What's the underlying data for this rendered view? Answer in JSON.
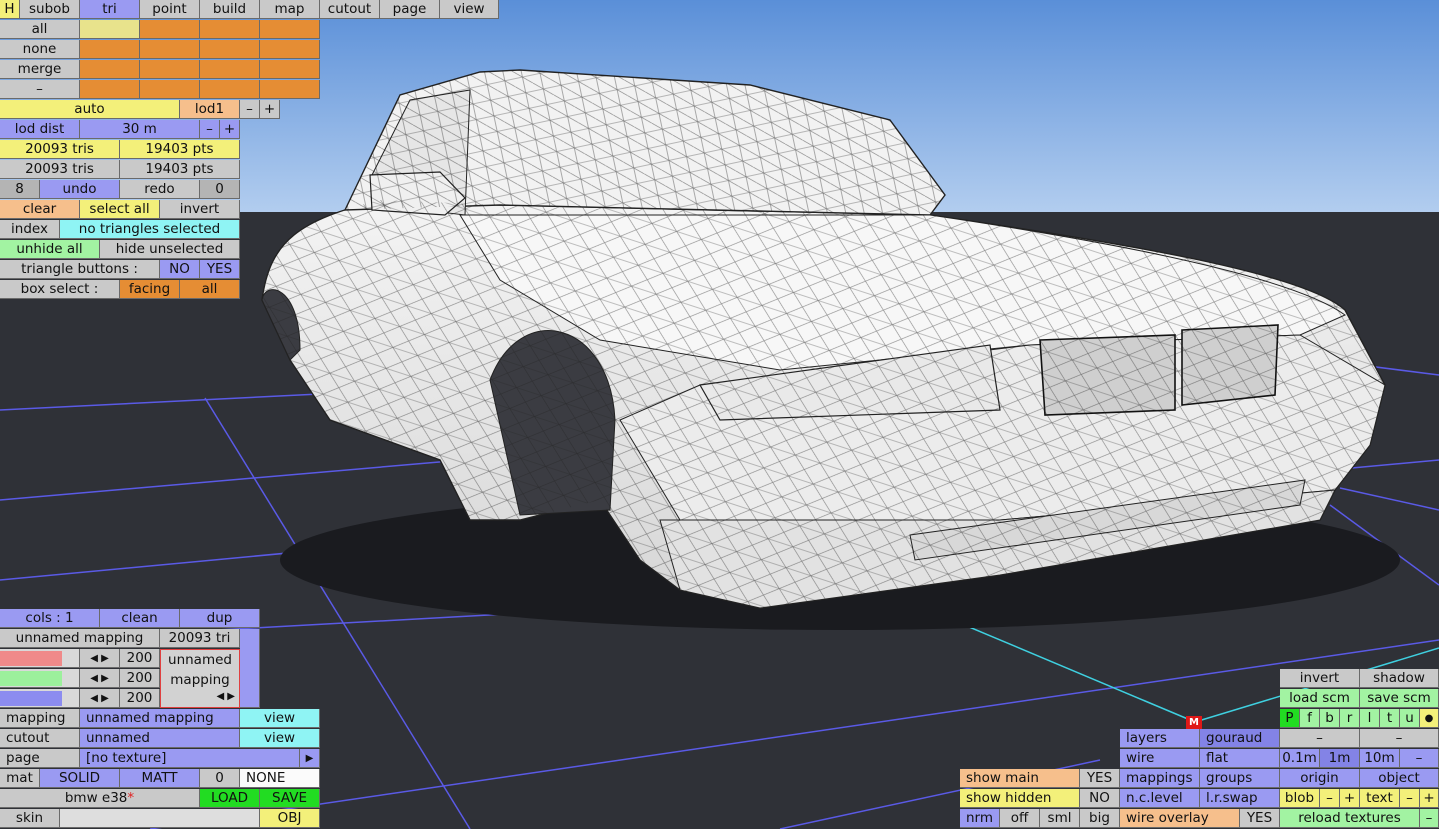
{
  "tabs": {
    "h": "H",
    "subob": "subob",
    "tri": "tri",
    "point": "point",
    "build": "build",
    "map": "map",
    "cutout": "cutout",
    "page": "page",
    "view": "view"
  },
  "selection": {
    "all": "all",
    "none": "none",
    "merge": "merge",
    "minus": "–"
  },
  "lod": {
    "auto": "auto",
    "level": "lod1",
    "minus": "–",
    "plus": "+",
    "dist_label": "lod dist",
    "dist_value": "30 m"
  },
  "stats": {
    "tris1": "20093 tris",
    "pts1": "19403 pts",
    "tris2": "20093 tris",
    "pts2": "19403 pts"
  },
  "history": {
    "undo_count": "8",
    "undo": "undo",
    "redo": "redo",
    "redo_count": "0"
  },
  "actions": {
    "clear": "clear",
    "select_all": "select all",
    "invert": "invert",
    "index": "index",
    "index_status": "no triangles selected",
    "unhide_all": "unhide all",
    "hide_unselected": "hide unselected"
  },
  "tri_buttons": {
    "label": "triangle buttons :",
    "no": "NO",
    "yes": "YES"
  },
  "box_select": {
    "label": "box select :",
    "facing": "facing",
    "all": "all"
  },
  "mapping_panel": {
    "cols": "cols : 1",
    "clean": "clean",
    "dup": "dup",
    "name": "unnamed mapping",
    "tri_count": "20093 tri",
    "r": "200",
    "g": "200",
    "b": "200",
    "preview_line1": "unnamed",
    "preview_line2": "mapping"
  },
  "props": {
    "mapping_label": "mapping",
    "mapping_value": "unnamed mapping",
    "view1": "view",
    "cutout_label": "cutout",
    "cutout_value": "unnamed",
    "view2": "view",
    "page_label": "page",
    "page_value": "[no texture]",
    "page_arrow": "▶",
    "mat_label": "mat",
    "solid": "SOLID",
    "matt": "MATT",
    "mat_num": "0",
    "mat_none": "NONE",
    "model_name": "bmw e38",
    "unsaved_marker": "*",
    "load": "LOAD",
    "save": "SAVE",
    "skin": "skin",
    "obj": "OBJ"
  },
  "display": {
    "show_main": "show main",
    "show_main_val": "YES",
    "show_hidden": "show hidden",
    "show_hidden_val": "NO",
    "nrm": "nrm",
    "off": "off",
    "sml": "sml",
    "big": "big",
    "layers": "layers",
    "gouraud": "gouraud",
    "wire": "wire",
    "flat": "flat",
    "mappings": "mappings",
    "groups": "groups",
    "nc_level": "n.c.level",
    "lr_swap": "l.r.swap",
    "wire_overlay": "wire overlay",
    "wire_overlay_val": "YES"
  },
  "right_panel": {
    "invert": "invert",
    "shadow": "shadow",
    "load_scm": "load scm",
    "save_scm": "save scm",
    "flags": [
      "P",
      "f",
      "b",
      "r",
      "l",
      "t",
      "u",
      "●"
    ],
    "minus1": "–",
    "minus2": "–",
    "d01": "0.1m",
    "d1": "1m",
    "d10": "10m",
    "dminus": "–",
    "origin": "origin",
    "object": "object",
    "blob": "blob",
    "blob_minus": "–",
    "blob_plus": "+",
    "text": "text",
    "text_minus": "–",
    "text_plus": "+",
    "reload_textures": "reload textures",
    "reload_minus": "–"
  },
  "marker": {
    "m": "M"
  },
  "colors": {
    "sky_top": "#5a8fd8",
    "sky_bottom": "#a9c8ee",
    "ground": "#2f3137",
    "grid": "#5a5ae6",
    "axis": "#3fd0e0",
    "panel_blue": "#9a9af2",
    "panel_orange": "#e58d34",
    "panel_yellow": "#f3f07a",
    "panel_green": "#a2f3a2",
    "panel_cyan": "#8ff4f4"
  }
}
